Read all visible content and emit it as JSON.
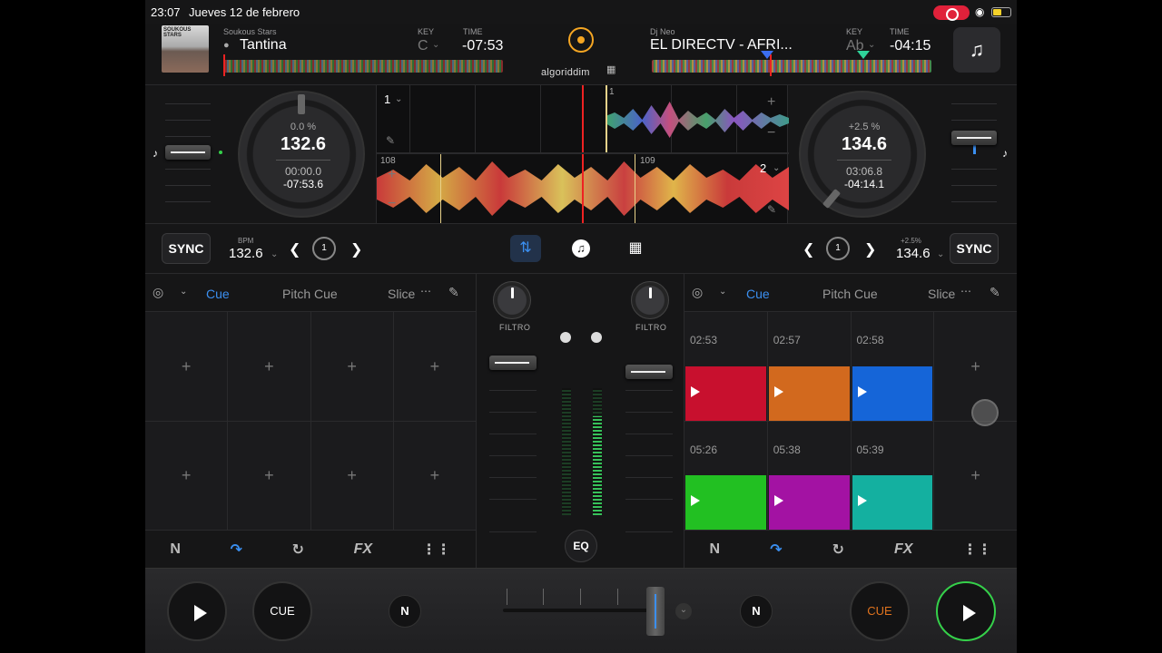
{
  "status": {
    "time": "23:07",
    "date": "Jueves 12 de febrero"
  },
  "deck_a": {
    "artist": "Soukous Stars",
    "title": "Tantina",
    "key_label": "KEY",
    "key": "C",
    "time_label": "TIME",
    "time": "-07:53",
    "pitch_pct": "0.0 %",
    "bpm": "132.6",
    "elapsed": "00:00.0",
    "remaining": "-07:53.6",
    "wave_lane": "1",
    "bpm_label": "BPM",
    "bpm_value": "132.6",
    "loop": "1",
    "beat_marker": "108",
    "pitch_fader_level": 0.5
  },
  "deck_b": {
    "artist": "Dj Neo",
    "title": "EL DIRECTV - AFRI...",
    "key_label": "KEY",
    "key": "Ab",
    "time_label": "TIME",
    "time": "-04:15",
    "pitch_pct": "+2.5 %",
    "bpm": "134.6",
    "elapsed": "03:06.8",
    "remaining": "-04:14.1",
    "wave_lane": "2",
    "marker_top": "1",
    "pitch_label": "+2.5%",
    "bpm_value": "134.6",
    "loop": "1",
    "beat_marker": "109",
    "pitch_fader_level": 0.35
  },
  "logo": {
    "text": "algoriddim"
  },
  "transport": {
    "sync_label": "SYNC"
  },
  "pads_left": {
    "tabs": [
      "Cue",
      "Pitch Cue",
      "Slice"
    ],
    "active_tab": "Cue",
    "plus": "+"
  },
  "pads_right": {
    "tabs": [
      "Cue",
      "Pitch Cue",
      "Slice"
    ],
    "active_tab": "Cue",
    "cues": [
      {
        "time": "02:53",
        "color": "#c8102e"
      },
      {
        "time": "02:57",
        "color": "#d2691e"
      },
      {
        "time": "02:58",
        "color": "#1565d8"
      },
      {
        "time": "05:26",
        "color": "#22c022"
      },
      {
        "time": "05:38",
        "color": "#a312a3"
      },
      {
        "time": "05:39",
        "color": "#14b0a0"
      }
    ],
    "plus": "+"
  },
  "mixer": {
    "filter_label": "FILTRO",
    "eq_label": "EQ",
    "meter_level_b": 0.78
  },
  "bottom": {
    "cue_label": "CUE"
  },
  "tools": {
    "fx": "FX"
  },
  "colors": {
    "accent": "#3b8ff0",
    "record": "#e0213a",
    "play_active": "#35d04a",
    "cue_active": "#e0731e"
  },
  "icons": [
    "music-note-icon",
    "logo-icon",
    "waveform-mode-icon",
    "grid-mode-icon",
    "loop-icon",
    "chevron-left-icon",
    "chevron-right-icon",
    "quantize-icon",
    "edit-icon",
    "more-icon",
    "neural-mix-icon",
    "auto-loop-icon",
    "loop-roll-icon",
    "fx-icon",
    "mixer-sliders-icon",
    "play-icon",
    "wifi-icon",
    "battery-icon",
    "record-icon"
  ]
}
